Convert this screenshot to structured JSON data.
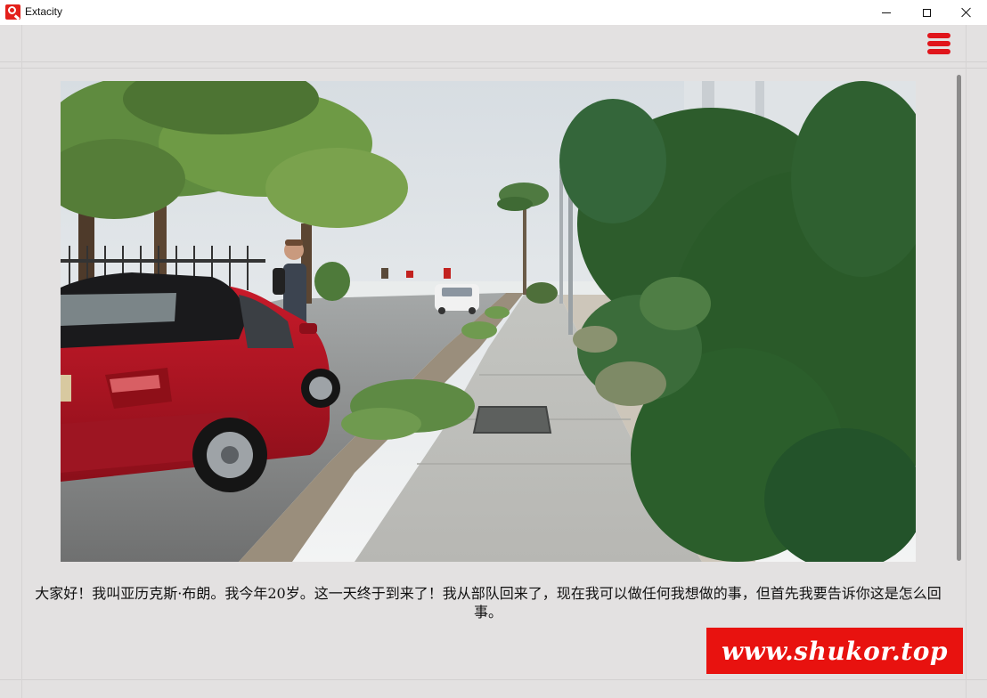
{
  "window": {
    "title": "Extacity",
    "controls": {
      "minimize_icon": "minimize-icon",
      "maximize_icon": "maximize-icon",
      "close_icon": "close-icon"
    }
  },
  "toolbar": {
    "menu_icon": "hamburger-menu-icon",
    "menu_color": "#e0151b"
  },
  "scene": {
    "image_name": "street-scene"
  },
  "dialogue": {
    "text": "大家好！我叫亚历克斯·布朗。我今年20岁。这一天终于到来了！我从部队回来了，现在我可以做任何我想做的事，但首先我要告诉你这是怎么回事。"
  },
  "watermark": {
    "text": "www.shukor.top",
    "color": "#e8120f"
  }
}
